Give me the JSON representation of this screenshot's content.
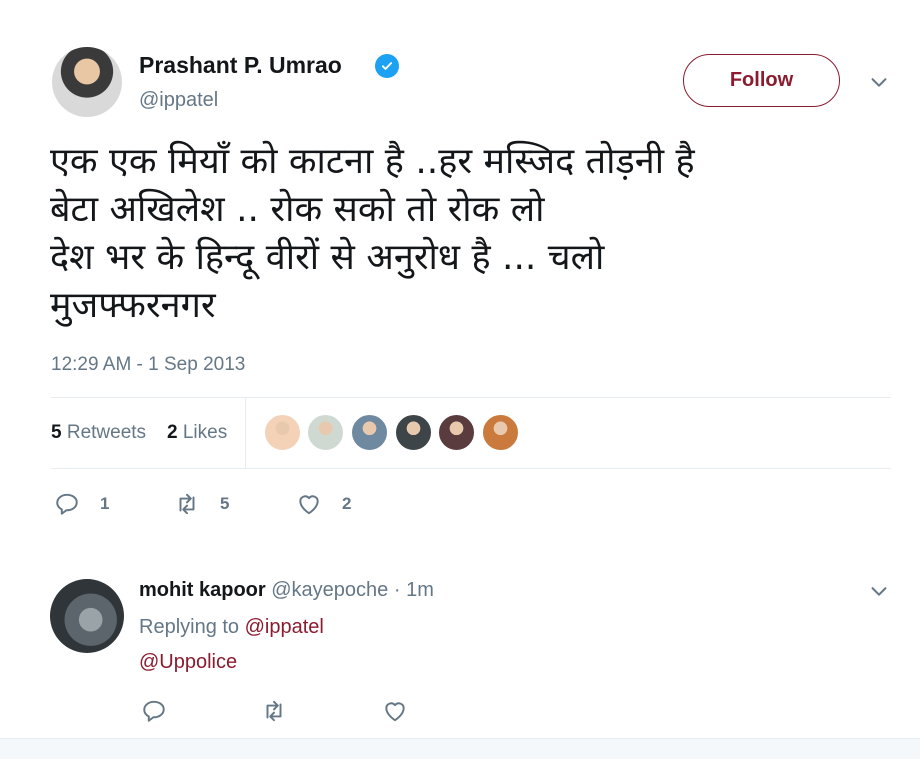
{
  "tweet": {
    "author_name": "Prashant P. Umrao",
    "author_handle": "@ippatel",
    "verified_icon": "verified-badge-icon",
    "follow_label": "Follow",
    "text_lines": [
      "एक एक मियाँ को काटना है ..हर मस्जिद तोड़नी है",
      "बेटा अखिलेश .. रोक सको तो रोक लो",
      "देश भर के हिन्दू वीरों से अनुरोध है ... चलो",
      "मुजफ्फरनगर"
    ],
    "timestamp": "12:29 AM - 1 Sep 2013",
    "retweets_count": "5",
    "retweets_label": "Retweets",
    "likes_count": "2",
    "likes_label": "Likes",
    "liker_avatars": [
      {
        "color": "#f3d2b8"
      },
      {
        "color": "#cfd9d2"
      },
      {
        "color": "#6f8aa0"
      },
      {
        "color": "#3e4548"
      },
      {
        "color": "#5a3c3f"
      },
      {
        "color": "#c97a3c"
      }
    ],
    "actions": {
      "reply_count": "1",
      "retweet_count": "5",
      "like_count": "2"
    }
  },
  "reply": {
    "author_name": "mohit kapoor",
    "author_handle": "@kayepoche",
    "separator": "·",
    "time": "1m",
    "replying_prefix": "Replying to",
    "replying_to": "@ippatel",
    "text": "@Uppolice"
  },
  "colors": {
    "accent": "#8b1c30",
    "verified": "#1da1f2",
    "muted": "#657786"
  }
}
